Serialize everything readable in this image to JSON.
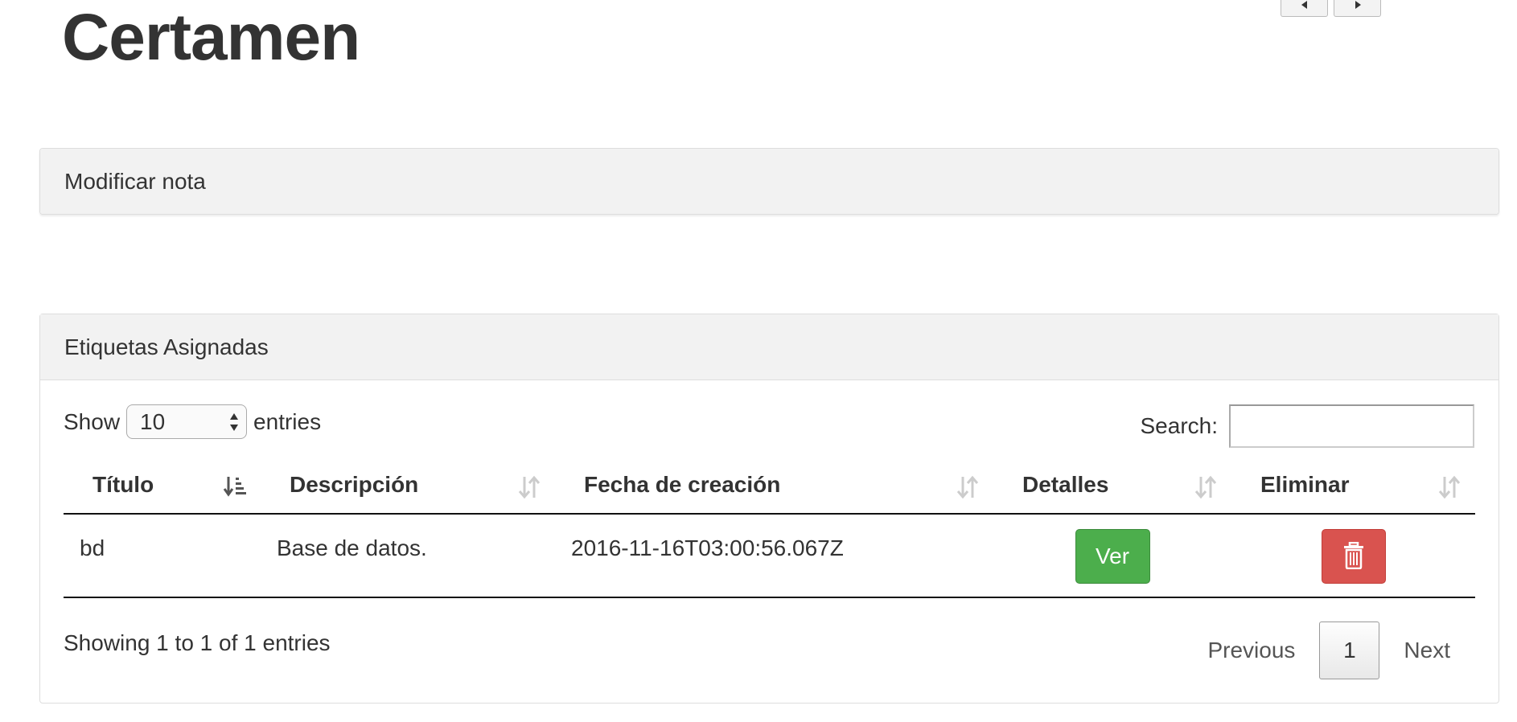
{
  "page": {
    "title": "Certamen"
  },
  "panels": {
    "modificar": {
      "heading": "Modificar nota"
    },
    "etiquetas": {
      "heading": "Etiquetas Asignadas",
      "length": {
        "prefix": "Show",
        "value": "10",
        "suffix": "entries"
      },
      "search": {
        "label": "Search:",
        "value": ""
      },
      "columns": [
        "Título",
        "Descripción",
        "Fecha de creación",
        "Detalles",
        "Eliminar"
      ],
      "rows": [
        {
          "titulo": "bd",
          "descripcion": "Base de datos.",
          "fecha": "2016-11-16T03:00:56.067Z",
          "ver_label": "Ver",
          "eliminar_icon": "trash-icon"
        }
      ],
      "info": "Showing 1 to 1 of 1 entries",
      "pagination": {
        "previous": "Previous",
        "current": "1",
        "next": "Next"
      }
    }
  },
  "colors": {
    "success": "#4cae4c",
    "danger": "#d9534f",
    "panel_heading_bg": "#f2f2f2"
  }
}
